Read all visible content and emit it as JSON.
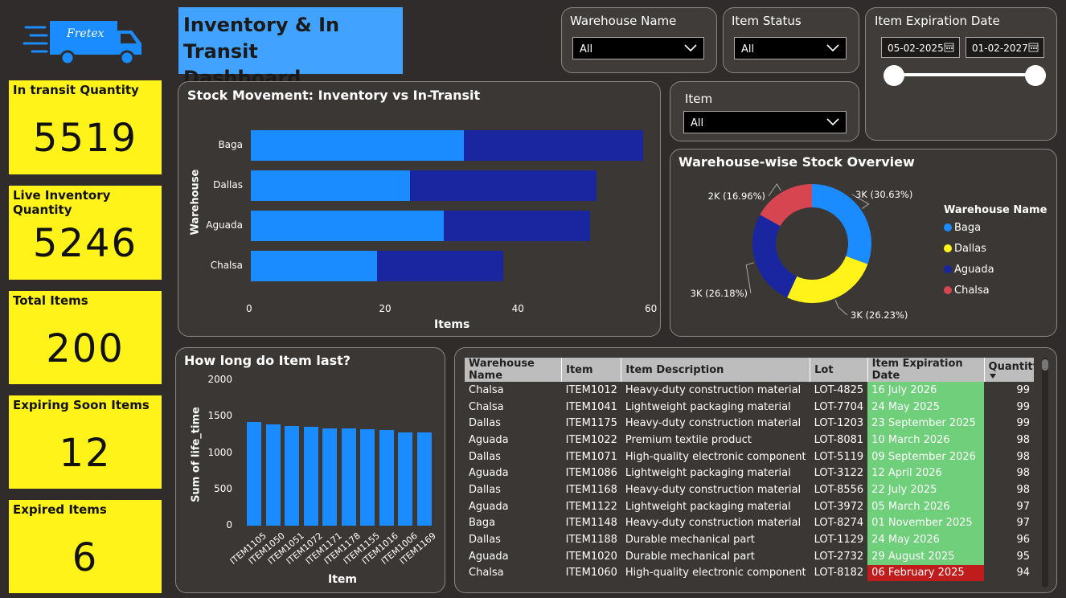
{
  "brand": {
    "logo_text": "Fretex"
  },
  "header": {
    "title_line1": "Inventory & In Transit",
    "title_line2": "Dashboard"
  },
  "kpis": [
    {
      "label": "In transit Quantity",
      "value": "5519"
    },
    {
      "label": "Live Inventory Quantity",
      "value": "5246"
    },
    {
      "label": "Total Items",
      "value": "200"
    },
    {
      "label": "Expiring Soon Items",
      "value": "12"
    },
    {
      "label": "Expired Items",
      "value": "6"
    }
  ],
  "slicers": {
    "warehouse": {
      "label": "Warehouse Name",
      "value": "All"
    },
    "status": {
      "label": "Item Status",
      "value": "All"
    },
    "item": {
      "label": "Item",
      "value": "All"
    },
    "expiration": {
      "label": "Item Expiration Date",
      "start": "05-02-2025",
      "end": "01-02-2027"
    }
  },
  "colors": {
    "light_blue": "#1a8cff",
    "dark_blue": "#1a26a0",
    "yellow": "#fff31a",
    "red": "#d64550",
    "green": "#6fcf7a",
    "expired_red": "#c11c1c"
  },
  "chart_data": [
    {
      "type": "bar",
      "orientation": "horizontal",
      "stacked": true,
      "title": "Stock Movement: Inventory vs In-Transit",
      "xlabel": "Items",
      "ylabel": "Warehouse",
      "categories": [
        "Baga",
        "Dallas",
        "Aguada",
        "Chalsa"
      ],
      "series": [
        {
          "values": [
            32,
            24,
            29,
            19
          ]
        },
        {
          "values": [
            27,
            28,
            22,
            19
          ]
        }
      ],
      "xlim": [
        0,
        60
      ],
      "xticks": [
        "0",
        "20",
        "40",
        "60"
      ]
    },
    {
      "type": "pie",
      "donut": true,
      "title": "Warehouse-wise Stock Overview",
      "legend_title": "Warehouse Name",
      "categories": [
        "Baga",
        "Dallas",
        "Aguada",
        "Chalsa"
      ],
      "values": [
        30.63,
        26.23,
        26.18,
        16.96
      ],
      "labels": [
        "3K (30.63%)",
        "3K (26.23%)",
        "3K (26.18%)",
        "2K (16.96%)"
      ],
      "legend_position": "right"
    },
    {
      "type": "bar",
      "title": "How long do Item last?",
      "xlabel": "Item",
      "ylabel": "Sum of life_time",
      "categories": [
        "ITEM1105",
        "ITEM1050",
        "ITEM1051",
        "ITEM1072",
        "ITEM1171",
        "ITEM1178",
        "ITEM1155",
        "ITEM1016",
        "ITEM1006",
        "ITEM1169"
      ],
      "values": [
        1420,
        1395,
        1365,
        1360,
        1340,
        1335,
        1330,
        1310,
        1285,
        1280
      ],
      "ylim": [
        0,
        2000
      ],
      "yticks": [
        "2000",
        "1500",
        "1000",
        "500",
        "0"
      ]
    }
  ],
  "table": {
    "columns": [
      "Warehouse Name",
      "Item",
      "Item Description",
      "Lot",
      "Item Expiration Date",
      "Quantity"
    ],
    "rows": [
      {
        "warehouse": "Chalsa",
        "item": "ITEM1012",
        "desc": "Heavy-duty construction material",
        "lot": "LOT-4825",
        "date": "16 July 2026",
        "qty": "99",
        "status": "ok"
      },
      {
        "warehouse": "Chalsa",
        "item": "ITEM1041",
        "desc": "Lightweight packaging material",
        "lot": "LOT-7704",
        "date": "24 May 2025",
        "qty": "99",
        "status": "ok"
      },
      {
        "warehouse": "Dallas",
        "item": "ITEM1175",
        "desc": "Heavy-duty construction material",
        "lot": "LOT-1203",
        "date": "23 September 2025",
        "qty": "99",
        "status": "ok"
      },
      {
        "warehouse": "Aguada",
        "item": "ITEM1022",
        "desc": "Premium textile product",
        "lot": "LOT-8081",
        "date": "10 March 2026",
        "qty": "98",
        "status": "ok"
      },
      {
        "warehouse": "Dallas",
        "item": "ITEM1071",
        "desc": "High-quality electronic component",
        "lot": "LOT-5119",
        "date": "09 September 2026",
        "qty": "98",
        "status": "ok"
      },
      {
        "warehouse": "Aguada",
        "item": "ITEM1086",
        "desc": "Lightweight packaging material",
        "lot": "LOT-3122",
        "date": "12 April 2026",
        "qty": "98",
        "status": "ok"
      },
      {
        "warehouse": "Dallas",
        "item": "ITEM1168",
        "desc": "Heavy-duty construction material",
        "lot": "LOT-8556",
        "date": "22 July 2025",
        "qty": "98",
        "status": "ok"
      },
      {
        "warehouse": "Aguada",
        "item": "ITEM1122",
        "desc": "Lightweight packaging material",
        "lot": "LOT-3972",
        "date": "05 March 2026",
        "qty": "97",
        "status": "ok"
      },
      {
        "warehouse": "Baga",
        "item": "ITEM1148",
        "desc": "Heavy-duty construction material",
        "lot": "LOT-8274",
        "date": "01 November 2025",
        "qty": "97",
        "status": "ok"
      },
      {
        "warehouse": "Dallas",
        "item": "ITEM1188",
        "desc": "Durable mechanical part",
        "lot": "LOT-1129",
        "date": "24 May 2026",
        "qty": "96",
        "status": "ok"
      },
      {
        "warehouse": "Aguada",
        "item": "ITEM1020",
        "desc": "Durable mechanical part",
        "lot": "LOT-2732",
        "date": "29 August 2025",
        "qty": "95",
        "status": "ok"
      },
      {
        "warehouse": "Chalsa",
        "item": "ITEM1060",
        "desc": "High-quality electronic component",
        "lot": "LOT-8182",
        "date": "06 February 2025",
        "qty": "94",
        "status": "expired"
      }
    ]
  }
}
